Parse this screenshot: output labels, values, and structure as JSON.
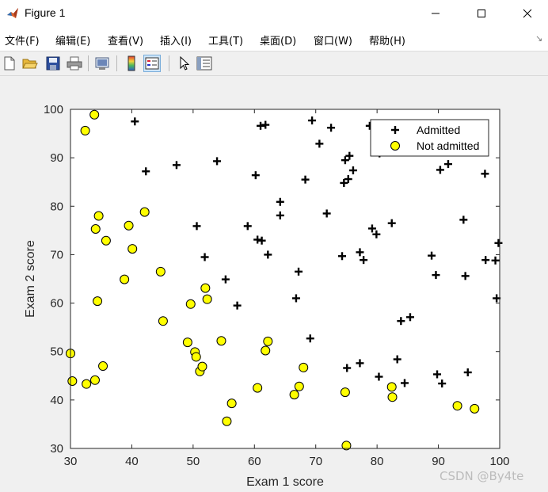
{
  "window": {
    "title": "Figure 1"
  },
  "menu": [
    {
      "label": "文件(F)"
    },
    {
      "label": "编辑(E)"
    },
    {
      "label": "查看(V)"
    },
    {
      "label": "插入(I)"
    },
    {
      "label": "工具(T)"
    },
    {
      "label": "桌面(D)"
    },
    {
      "label": "窗口(W)"
    },
    {
      "label": "帮助(H)"
    }
  ],
  "toolbar": {
    "buttons": [
      "new-figure-icon",
      "open-file-icon",
      "save-icon",
      "print-icon",
      "link-plot-icon",
      "insert-colorbar-icon",
      "insert-legend-icon",
      "edit-plot-icon",
      "property-inspector-icon"
    ],
    "active": "insert-legend-icon"
  },
  "watermark": "CSDN @By4te",
  "chart_data": {
    "type": "scatter",
    "xlabel": "Exam 1 score",
    "ylabel": "Exam 2 score",
    "xlim": [
      30,
      100
    ],
    "ylim": [
      30,
      100
    ],
    "xticks": [
      "30",
      "40",
      "50",
      "60",
      "70",
      "80",
      "90",
      "100"
    ],
    "yticks": [
      "30",
      "40",
      "50",
      "60",
      "70",
      "80",
      "90",
      "100"
    ],
    "grid": false,
    "legend": {
      "position": "top-right",
      "entries": [
        "Admitted",
        "Not admitted"
      ]
    },
    "colors": {
      "admitted": "#000000",
      "not_admitted_fill": "#ffff00",
      "not_admitted_edge": "#000000"
    },
    "series": [
      {
        "name": "Admitted",
        "marker": "+",
        "points": [
          [
            40.5,
            97.5
          ],
          [
            42.3,
            87.2
          ],
          [
            47.3,
            88.5
          ],
          [
            50.6,
            75.9
          ],
          [
            51.9,
            69.5
          ],
          [
            53.9,
            89.3
          ],
          [
            55.3,
            64.9
          ],
          [
            57.2,
            59.5
          ],
          [
            58.9,
            75.9
          ],
          [
            60.2,
            86.4
          ],
          [
            60.5,
            73.1
          ],
          [
            61.2,
            72.9
          ],
          [
            61.0,
            96.6
          ],
          [
            61.8,
            96.8
          ],
          [
            62.2,
            70.0
          ],
          [
            64.2,
            80.9
          ],
          [
            64.2,
            78.1
          ],
          [
            66.8,
            61.0
          ],
          [
            67.2,
            66.5
          ],
          [
            68.3,
            85.5
          ],
          [
            69.1,
            52.7
          ],
          [
            69.4,
            97.7
          ],
          [
            70.6,
            92.9
          ],
          [
            71.8,
            78.5
          ],
          [
            72.5,
            96.2
          ],
          [
            74.3,
            69.7
          ],
          [
            74.6,
            84.8
          ],
          [
            74.8,
            89.5
          ],
          [
            75.3,
            85.6
          ],
          [
            75.5,
            90.4
          ],
          [
            75.1,
            46.6
          ],
          [
            76.1,
            87.4
          ],
          [
            77.2,
            70.5
          ],
          [
            77.8,
            68.9
          ],
          [
            77.2,
            47.6
          ],
          [
            78.8,
            96.6
          ],
          [
            79.2,
            75.4
          ],
          [
            79.9,
            74.2
          ],
          [
            80.3,
            44.8
          ],
          [
            80.4,
            90.9
          ],
          [
            82.4,
            76.5
          ],
          [
            83.3,
            48.4
          ],
          [
            83.9,
            56.3
          ],
          [
            84.5,
            43.5
          ],
          [
            85.4,
            57.1
          ],
          [
            88.9,
            69.8
          ],
          [
            89.6,
            65.8
          ],
          [
            89.8,
            45.3
          ],
          [
            90.3,
            87.5
          ],
          [
            90.6,
            43.4
          ],
          [
            91.6,
            88.7
          ],
          [
            94.1,
            77.2
          ],
          [
            94.4,
            65.6
          ],
          [
            94.8,
            45.7
          ],
          [
            97.6,
            86.7
          ],
          [
            97.7,
            68.9
          ],
          [
            99.3,
            68.8
          ],
          [
            99.5,
            61.0
          ],
          [
            99.8,
            72.4
          ]
        ]
      },
      {
        "name": "Not admitted",
        "marker": "o",
        "points": [
          [
            30.3,
            43.9
          ],
          [
            30.0,
            49.6
          ],
          [
            32.4,
            95.6
          ],
          [
            32.6,
            43.3
          ],
          [
            33.9,
            98.9
          ],
          [
            34.0,
            44.1
          ],
          [
            34.1,
            75.3
          ],
          [
            34.4,
            60.4
          ],
          [
            34.6,
            78.0
          ],
          [
            35.3,
            47.0
          ],
          [
            35.8,
            72.9
          ],
          [
            38.8,
            64.9
          ],
          [
            39.5,
            76.0
          ],
          [
            40.1,
            71.2
          ],
          [
            42.1,
            78.8
          ],
          [
            44.7,
            66.5
          ],
          [
            45.1,
            56.3
          ],
          [
            49.1,
            51.9
          ],
          [
            49.6,
            59.8
          ],
          [
            50.3,
            49.9
          ],
          [
            50.5,
            48.9
          ],
          [
            51.1,
            45.9
          ],
          [
            51.5,
            46.9
          ],
          [
            52.0,
            63.1
          ],
          [
            52.3,
            60.8
          ],
          [
            54.6,
            52.2
          ],
          [
            55.5,
            35.6
          ],
          [
            56.3,
            39.3
          ],
          [
            60.5,
            42.5
          ],
          [
            61.8,
            50.2
          ],
          [
            62.2,
            52.1
          ],
          [
            66.5,
            41.1
          ],
          [
            67.3,
            42.8
          ],
          [
            68.0,
            46.7
          ],
          [
            74.8,
            41.6
          ],
          [
            75.0,
            30.6
          ],
          [
            82.4,
            42.7
          ],
          [
            82.5,
            40.6
          ],
          [
            93.1,
            38.8
          ],
          [
            95.9,
            38.2
          ]
        ]
      }
    ]
  }
}
